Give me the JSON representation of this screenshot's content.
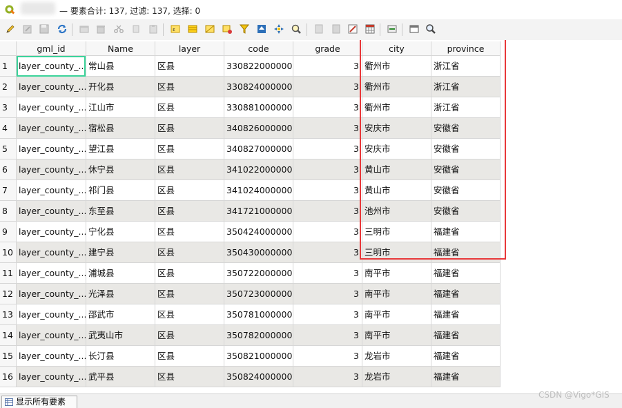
{
  "title": {
    "text": "— 要素合计: 137, 过滤: 137, 选择: 0"
  },
  "toolbar": {
    "icons": [
      "pencil-icon",
      "edit-multi-icon",
      "save-icon",
      "reload-icon",
      "add-feature-icon",
      "delete-icon",
      "cut-icon",
      "copy-icon",
      "paste-icon",
      "select-expression-icon",
      "select-all-icon",
      "invert-selection-icon",
      "deselect-icon",
      "filter-icon",
      "move-to-top-icon",
      "pan-to-selected-icon",
      "zoom-to-selected-icon",
      "new-field-icon",
      "delete-field-icon",
      "field-calculator-icon",
      "conditional-format-icon",
      "actions-icon",
      "dock-icon",
      "zoom-icon"
    ]
  },
  "table": {
    "columns": [
      "gml_id",
      "Name",
      "layer",
      "code",
      "grade",
      "city",
      "province"
    ],
    "rows": [
      {
        "num": "1",
        "gml_id": "layer_county_...",
        "name": "常山县",
        "layer": "区县",
        "code": "330822000000",
        "grade": "3",
        "city": "衢州市",
        "province": "浙江省"
      },
      {
        "num": "2",
        "gml_id": "layer_county_...",
        "name": "开化县",
        "layer": "区县",
        "code": "330824000000",
        "grade": "3",
        "city": "衢州市",
        "province": "浙江省"
      },
      {
        "num": "3",
        "gml_id": "layer_county_...",
        "name": "江山市",
        "layer": "区县",
        "code": "330881000000",
        "grade": "3",
        "city": "衢州市",
        "province": "浙江省"
      },
      {
        "num": "4",
        "gml_id": "layer_county_...",
        "name": "宿松县",
        "layer": "区县",
        "code": "340826000000",
        "grade": "3",
        "city": "安庆市",
        "province": "安徽省"
      },
      {
        "num": "5",
        "gml_id": "layer_county_...",
        "name": "望江县",
        "layer": "区县",
        "code": "340827000000",
        "grade": "3",
        "city": "安庆市",
        "province": "安徽省"
      },
      {
        "num": "6",
        "gml_id": "layer_county_...",
        "name": "休宁县",
        "layer": "区县",
        "code": "341022000000",
        "grade": "3",
        "city": "黄山市",
        "province": "安徽省"
      },
      {
        "num": "7",
        "gml_id": "layer_county_...",
        "name": "祁门县",
        "layer": "区县",
        "code": "341024000000",
        "grade": "3",
        "city": "黄山市",
        "province": "安徽省"
      },
      {
        "num": "8",
        "gml_id": "layer_county_...",
        "name": "东至县",
        "layer": "区县",
        "code": "341721000000",
        "grade": "3",
        "city": "池州市",
        "province": "安徽省"
      },
      {
        "num": "9",
        "gml_id": "layer_county_...",
        "name": "宁化县",
        "layer": "区县",
        "code": "350424000000",
        "grade": "3",
        "city": "三明市",
        "province": "福建省"
      },
      {
        "num": "10",
        "gml_id": "layer_county_...",
        "name": "建宁县",
        "layer": "区县",
        "code": "350430000000",
        "grade": "3",
        "city": "三明市",
        "province": "福建省"
      },
      {
        "num": "11",
        "gml_id": "layer_county_...",
        "name": "浦城县",
        "layer": "区县",
        "code": "350722000000",
        "grade": "3",
        "city": "南平市",
        "province": "福建省"
      },
      {
        "num": "12",
        "gml_id": "layer_county_...",
        "name": "光泽县",
        "layer": "区县",
        "code": "350723000000",
        "grade": "3",
        "city": "南平市",
        "province": "福建省"
      },
      {
        "num": "13",
        "gml_id": "layer_county_...",
        "name": "邵武市",
        "layer": "区县",
        "code": "350781000000",
        "grade": "3",
        "city": "南平市",
        "province": "福建省"
      },
      {
        "num": "14",
        "gml_id": "layer_county_...",
        "name": "武夷山市",
        "layer": "区县",
        "code": "350782000000",
        "grade": "3",
        "city": "南平市",
        "province": "福建省"
      },
      {
        "num": "15",
        "gml_id": "layer_county_...",
        "name": "长汀县",
        "layer": "区县",
        "code": "350821000000",
        "grade": "3",
        "city": "龙岩市",
        "province": "福建省"
      },
      {
        "num": "16",
        "gml_id": "layer_county_...",
        "name": "武平县",
        "layer": "区县",
        "code": "350824000000",
        "grade": "3",
        "city": "龙岩市",
        "province": "福建省"
      }
    ]
  },
  "bottom": {
    "show_all_label": "显示所有要素"
  },
  "watermark": "CSDN @Vigo*GIS",
  "colors": {
    "highlight_box": "#e8383a",
    "selected_cell": "#3bd39a",
    "alt_row": "#e9e8e5"
  }
}
